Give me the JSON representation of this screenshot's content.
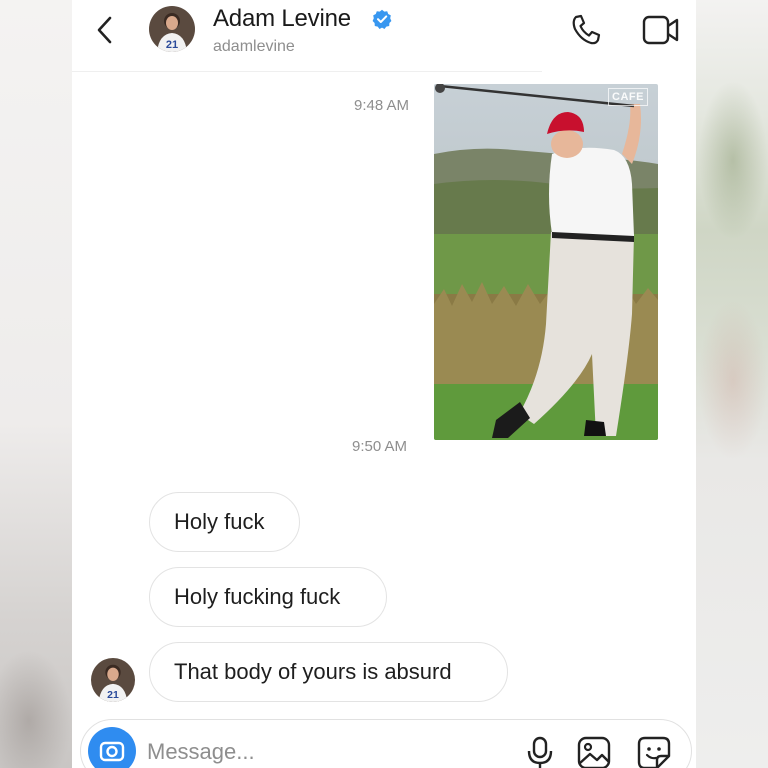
{
  "header": {
    "name": "Adam Levine",
    "username": "adamlevine",
    "verified": true,
    "avatar_jersey_number": "21"
  },
  "messages": {
    "timestamp_1": "9:48 AM",
    "photo_caption": "CAFE",
    "timestamp_2": "9:50 AM",
    "received": [
      {
        "text": "Holy fuck"
      },
      {
        "text": "Holy fucking fuck"
      },
      {
        "text": "That body of yours is absurd"
      }
    ]
  },
  "composer": {
    "placeholder": "Message..."
  },
  "colors": {
    "verified_badge": "#3897f0",
    "camera_button": "#2f8cf0",
    "timestamp": "#8e8e8e"
  },
  "icons": [
    "back-chevron-icon",
    "verified-badge-icon",
    "phone-icon",
    "video-camera-icon",
    "camera-icon",
    "microphone-icon",
    "gallery-icon",
    "sticker-icon"
  ]
}
